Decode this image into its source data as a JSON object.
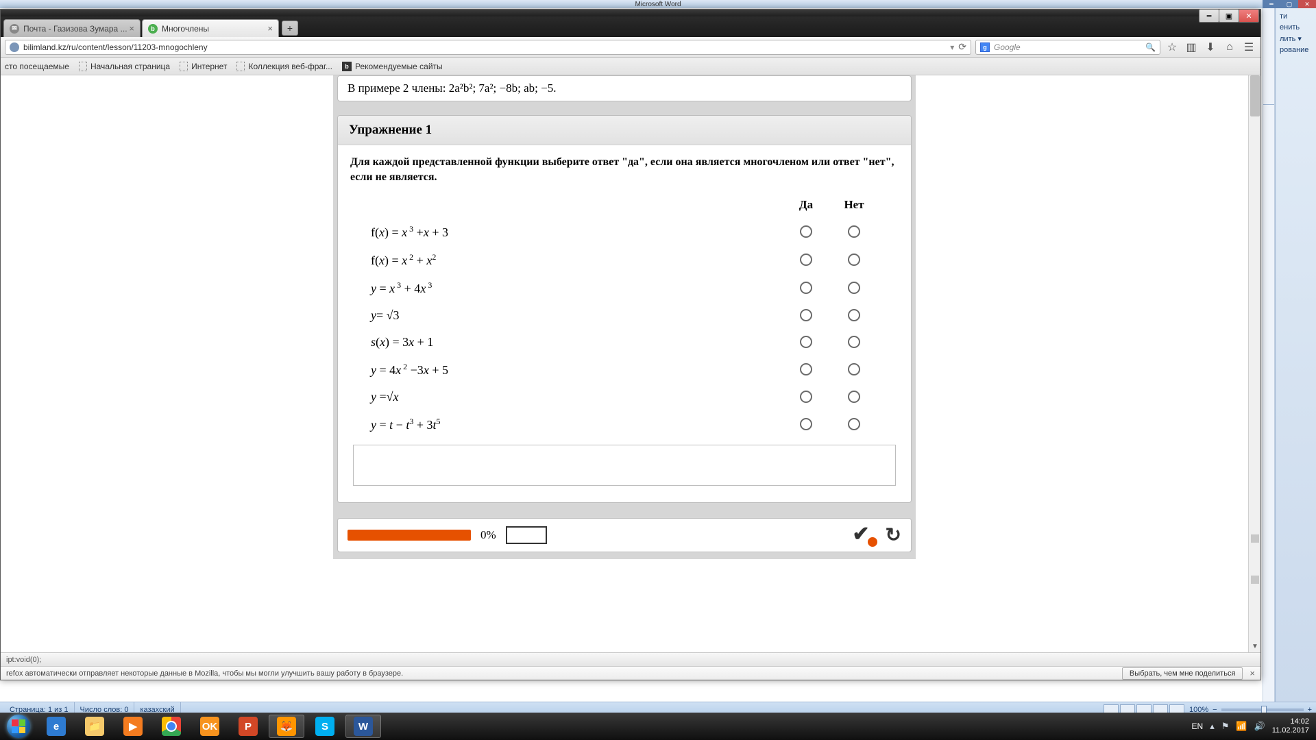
{
  "word": {
    "title_fragment": "Microsoft Word",
    "side_items": [
      "ти",
      "енить",
      "лить ▾",
      "рование"
    ],
    "status": {
      "page": "Страница: 1 из 1",
      "words": "Число слов: 0",
      "lang": "казахский",
      "zoom": "100%"
    }
  },
  "firefox": {
    "tabs": [
      {
        "title": "Почта - Газизова Зумара ...",
        "active": false
      },
      {
        "title": "Многочлены",
        "active": true
      }
    ],
    "url": "bilimland.kz/ru/content/lesson/11203-mnogochleny",
    "search_engine": "g",
    "search_placeholder": "Google",
    "bookmarks": [
      "сто посещаемые",
      "Начальная страница",
      "Интернет",
      "Коллекция веб-фраг...",
      "Рекомендуемые сайты"
    ],
    "status_text": "ipt:void(0);",
    "notification": "refox автоматически отправляет некоторые данные в Mozilla, чтобы мы могли улучшить вашу работу в браузере.",
    "notification_button": "Выбрать, чем мне поделиться"
  },
  "lesson": {
    "prev_line": "В примере 2 члены: 2a²b²; 7a²; −8b; ab; −5.",
    "exercise_title": "Упражнение 1",
    "instruction": "Для каждой представленной функции выберите ответ \"да\", если она является многочленом или ответ \"нет\", если не является.",
    "col_yes": "Да",
    "col_no": "Нет",
    "functions": [
      "f(x) = x³ + x + 3",
      "f(x) = x² + x²",
      "y = x³ + 4x³",
      "y = √3",
      "s(x) = 3x + 1",
      "y = 4x² − 3x + 5",
      "y = √x",
      "y = t − t³ + 3t⁵"
    ],
    "progress_pct": "0%"
  },
  "taskbar": {
    "lang": "EN",
    "time": "14:02",
    "date": "11.02.2017"
  }
}
